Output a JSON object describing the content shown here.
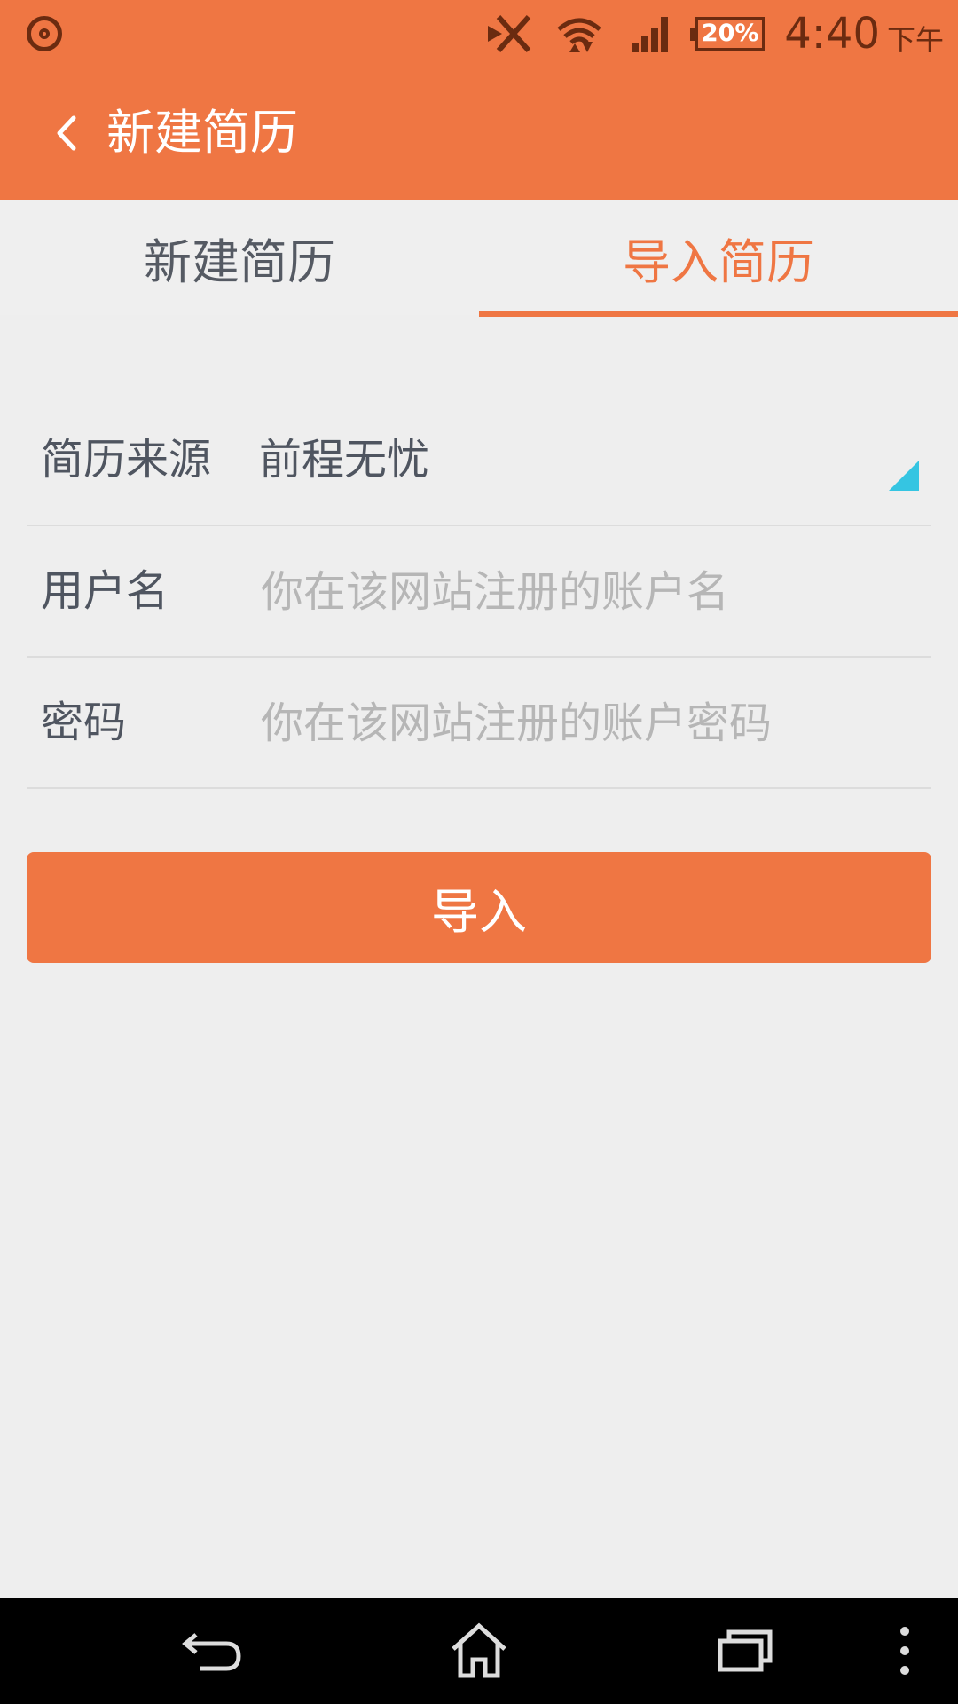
{
  "status_bar": {
    "battery_text": "20%",
    "time": "4:40",
    "ampm": "下午",
    "icons": [
      "app-notification-icon",
      "nfc-icon",
      "wifi-icon",
      "signal-icon",
      "battery-icon"
    ]
  },
  "app_bar": {
    "title": "新建简历",
    "back_icon": "chevron-left-icon"
  },
  "tabs": {
    "create_label": "新建简历",
    "import_label": "导入简历",
    "active_index": 1
  },
  "form": {
    "source": {
      "label": "简历来源",
      "value": "前程无忧"
    },
    "username": {
      "label": "用户名",
      "placeholder": "你在该网站注册的账户名",
      "value": ""
    },
    "password": {
      "label": "密码",
      "placeholder": "你在该网站注册的账户密码",
      "value": ""
    }
  },
  "import_button": {
    "label": "导入"
  },
  "colors": {
    "accent": "#ef7643",
    "background": "#eeeeee",
    "dropdown_indicator": "#35c5e2"
  },
  "nav_bar": {
    "icons": [
      "back-icon",
      "home-icon",
      "recent-apps-icon",
      "overflow-menu-icon"
    ]
  }
}
